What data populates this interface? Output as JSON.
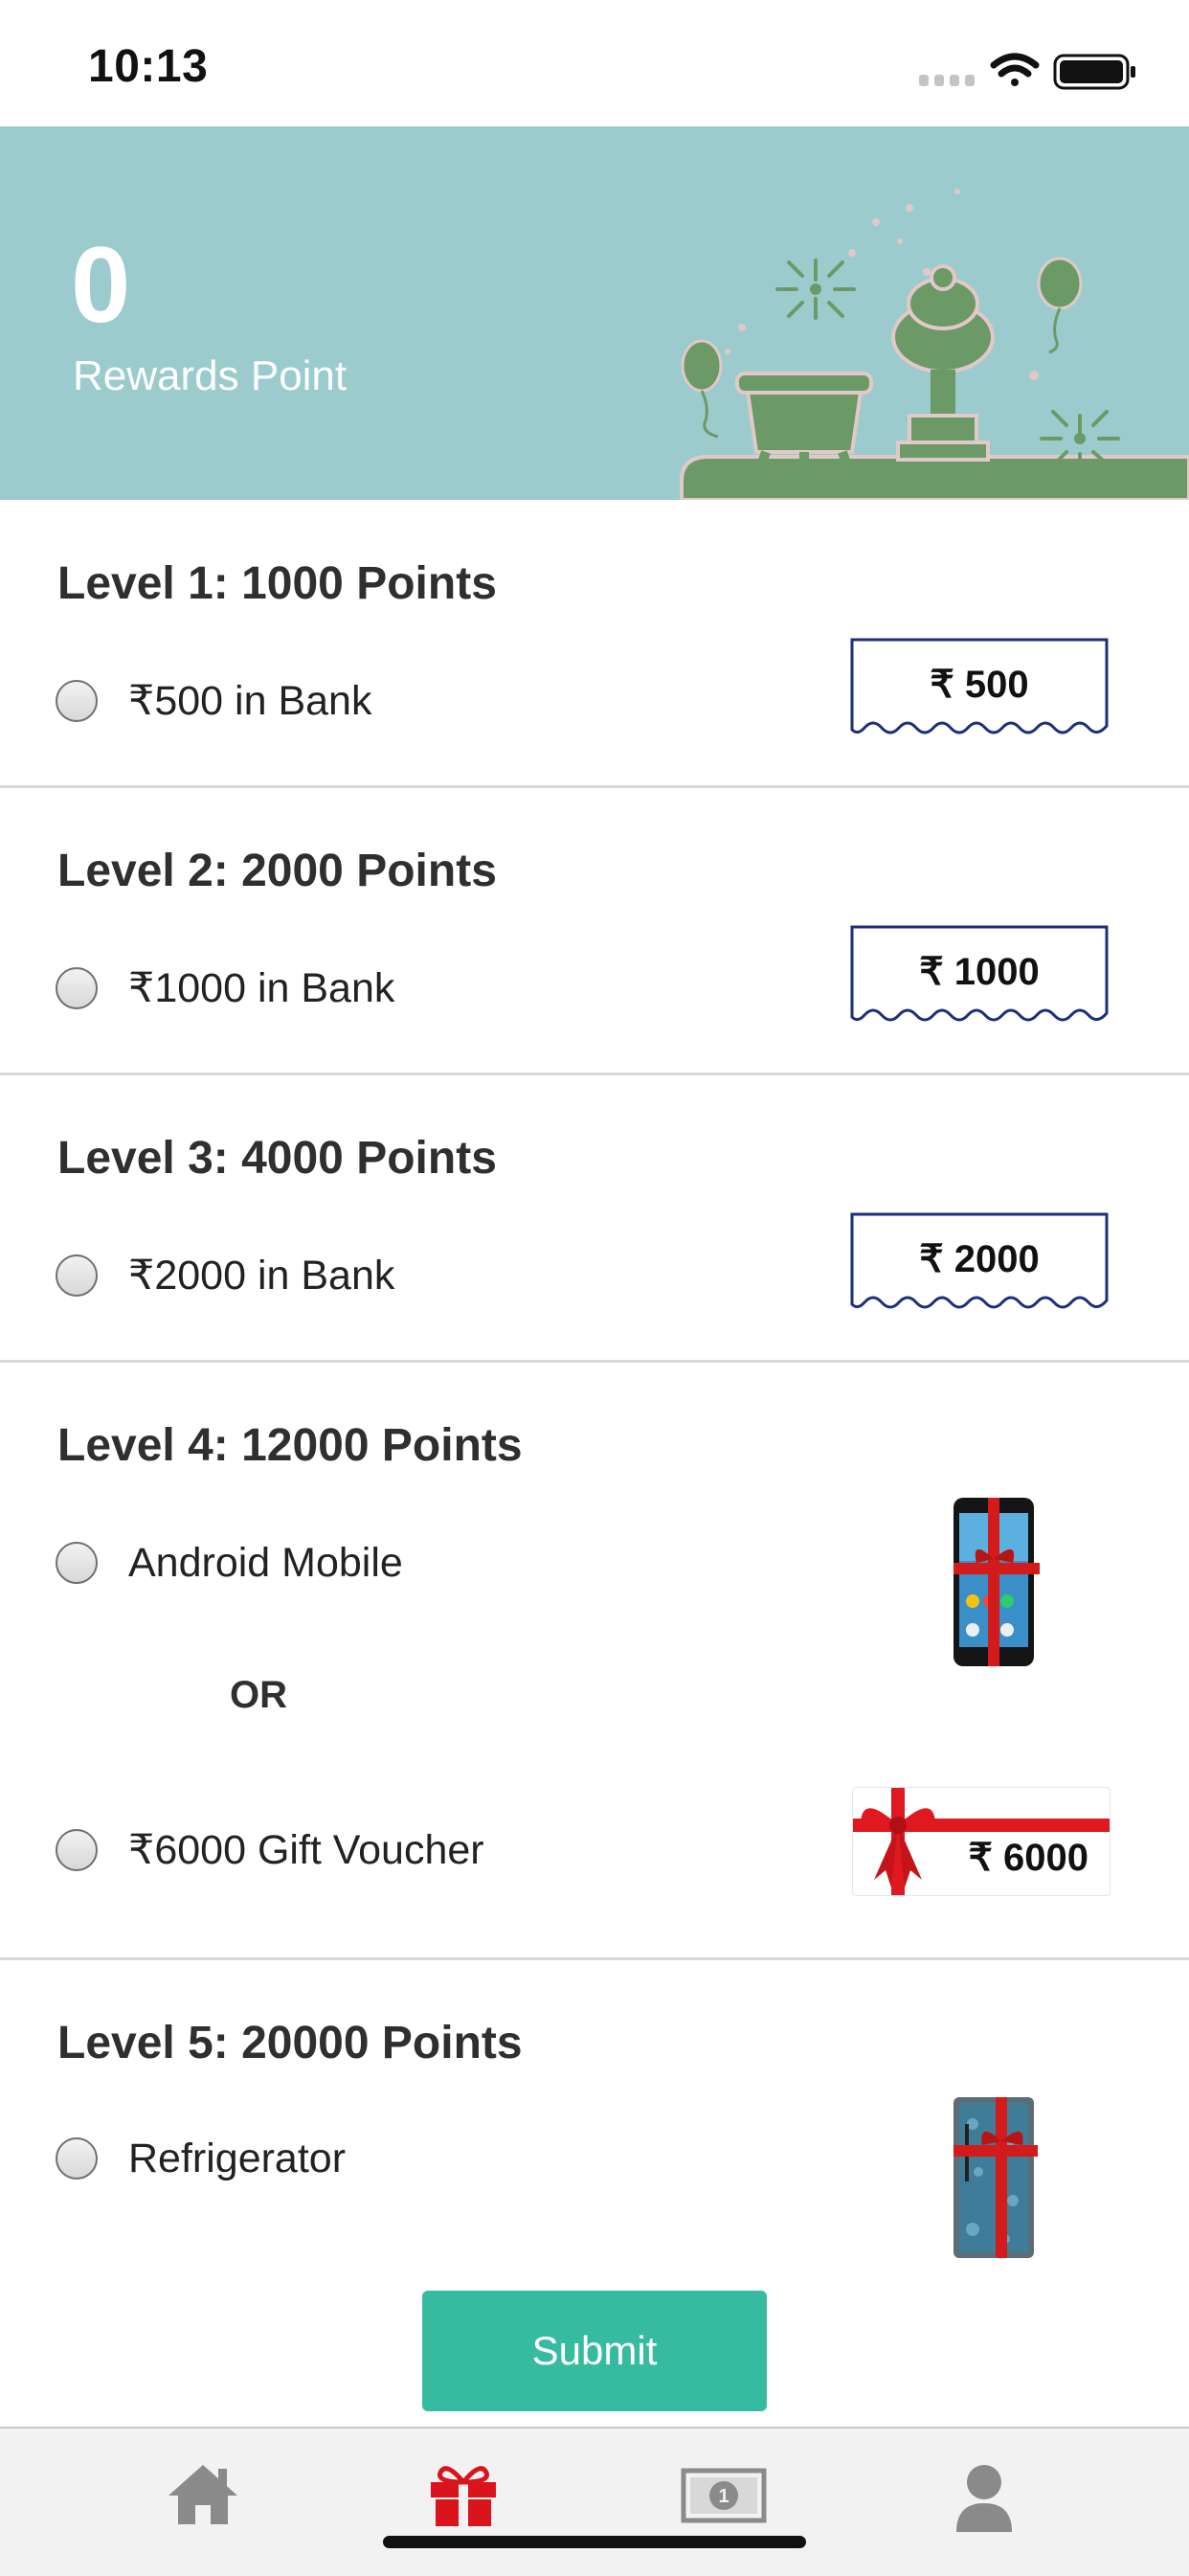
{
  "status_bar": {
    "time": "10:13"
  },
  "rewards": {
    "points": "0",
    "label": "Rewards Point"
  },
  "levels": [
    {
      "title": "Level 1: 1000 Points",
      "options": [
        {
          "label": "₹500 in Bank",
          "badge": "₹ 500"
        }
      ]
    },
    {
      "title": "Level 2: 2000 Points",
      "options": [
        {
          "label": "₹1000 in Bank",
          "badge": "₹ 1000"
        }
      ]
    },
    {
      "title": "Level 3: 4000 Points",
      "options": [
        {
          "label": "₹2000 in Bank",
          "badge": "₹ 2000"
        }
      ]
    },
    {
      "title": "Level 4: 12000 Points",
      "options": [
        {
          "label": "Android Mobile"
        },
        {
          "label": "₹6000 Gift Voucher",
          "badge": "₹ 6000"
        }
      ],
      "separator": "OR"
    },
    {
      "title": "Level 5: 20000 Points",
      "options": [
        {
          "label": "Refrigerator"
        }
      ]
    }
  ],
  "submit_label": "Submit",
  "tabs": [
    {
      "icon": "home-icon",
      "active": false
    },
    {
      "icon": "gift-icon",
      "active": true
    },
    {
      "icon": "cash-icon",
      "active": false
    },
    {
      "icon": "user-icon",
      "active": false
    }
  ],
  "colors": {
    "banner": "#9bcbcc",
    "accent": "#37bba0",
    "active_tab": "#d9141c",
    "inactive_tab": "#8a8a8a"
  }
}
